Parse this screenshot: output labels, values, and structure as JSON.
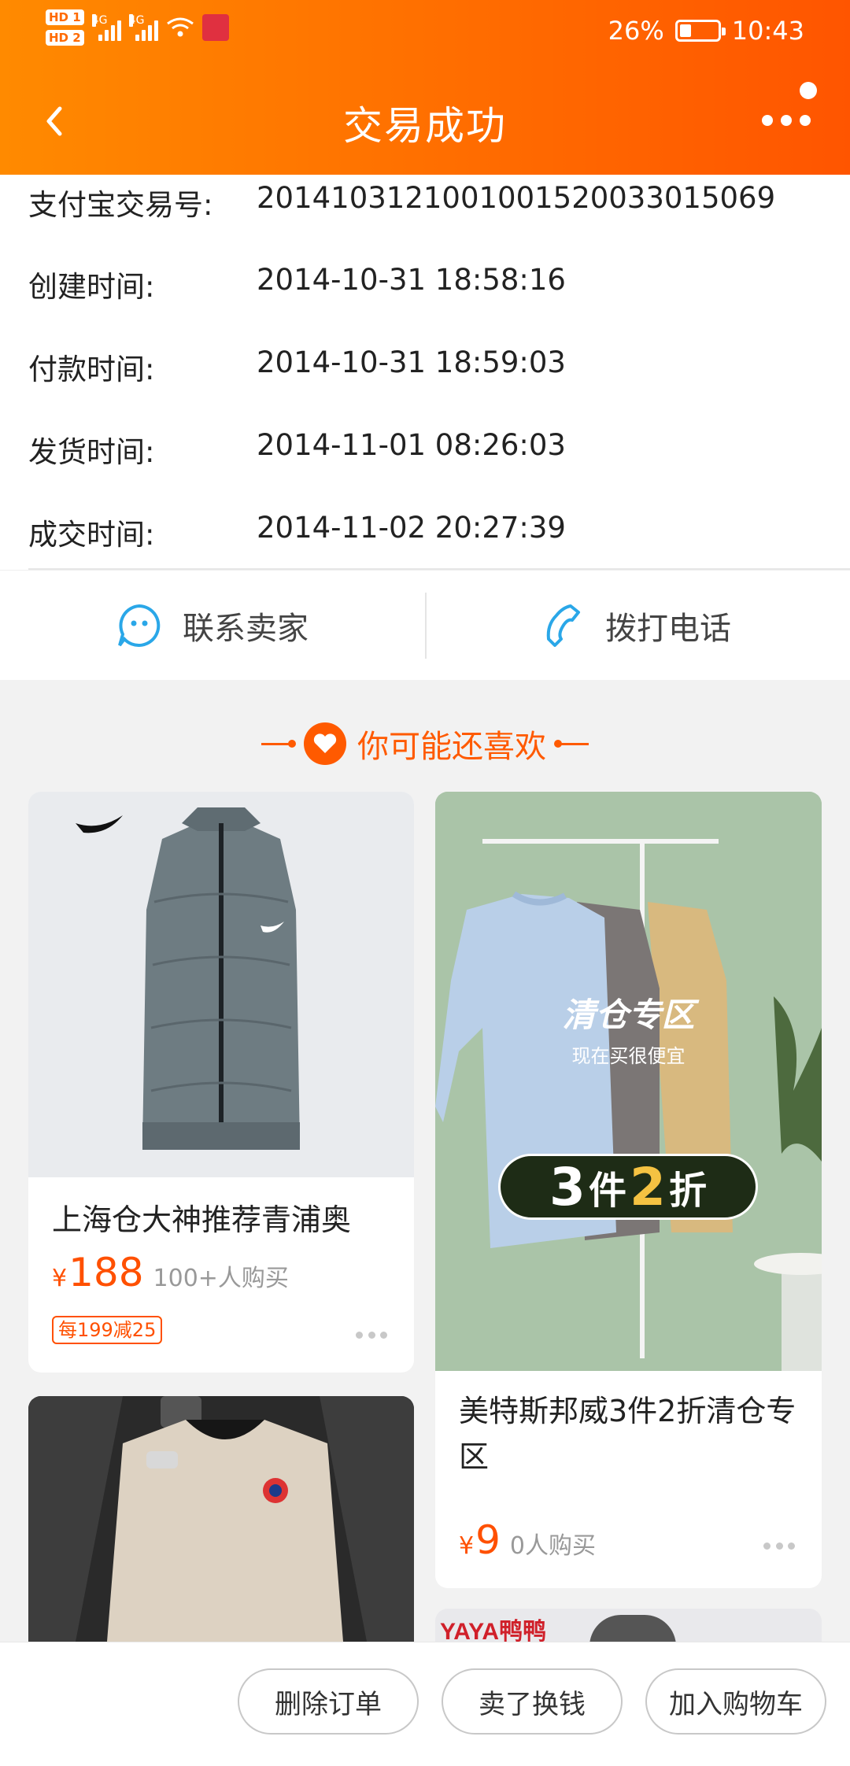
{
  "status_bar": {
    "hd1": "HD 1",
    "hd2": "HD 2",
    "net1": "4G",
    "net2": "4G",
    "battery_percent": "26%",
    "time": "10:43"
  },
  "header": {
    "title": "交易成功"
  },
  "order_info": [
    {
      "label": "支付宝交易号:",
      "value": "2014103121001001520033015069"
    },
    {
      "label": "创建时间:",
      "value": "2014-10-31 18:58:16"
    },
    {
      "label": "付款时间:",
      "value": "2014-10-31 18:59:03"
    },
    {
      "label": "发货时间:",
      "value": "2014-11-01 08:26:03"
    },
    {
      "label": "成交时间:",
      "value": "2014-11-02 20:27:39"
    }
  ],
  "contact": {
    "seller_label": "联系卖家",
    "call_label": "拨打电话"
  },
  "recommend": {
    "title": "你可能还喜欢"
  },
  "products": [
    {
      "title": "上海仓大神推荐青浦奥",
      "price_symbol": "¥",
      "price": "188",
      "sold": "100+人购买",
      "promo": "每199减25"
    },
    {
      "title": "美特斯邦威3件2折清仓专区",
      "price_symbol": "¥",
      "price": "9",
      "sold": "0人购买",
      "banner_title": "清仓专区",
      "banner_sub": "现在买很便宜",
      "banner_deal_a": "3",
      "banner_deal_b": "件",
      "banner_deal_c": "2",
      "banner_deal_d": "折"
    },
    {
      "brand_text": "YAYA鸭鸭"
    }
  ],
  "bottom_bar": {
    "delete_order": "删除订单",
    "sell_for_cash": "卖了换钱",
    "add_to_cart": "加入购物车"
  },
  "colors": {
    "brand": "#ff6a00",
    "price": "#ff5000",
    "accent_blue": "#2aa7e8"
  }
}
